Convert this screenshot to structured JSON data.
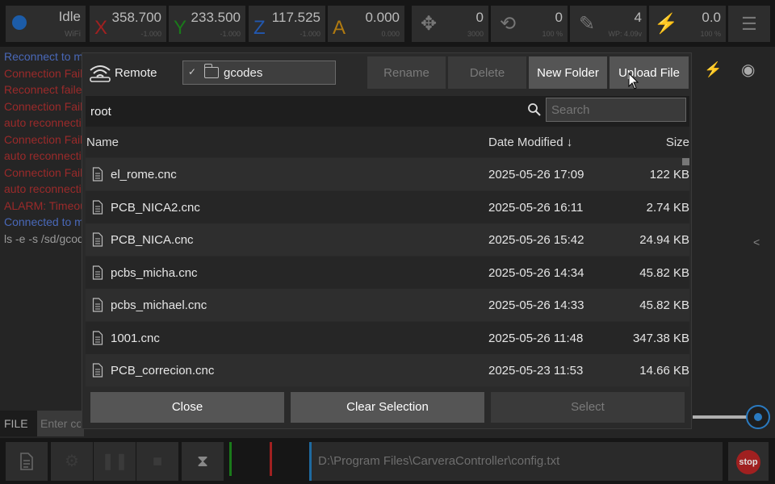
{
  "status_bar": {
    "state": "Idle",
    "connection": "WiFi",
    "axes": [
      {
        "letter": "X",
        "value": "358.700",
        "sub": "-1.000",
        "color": "#a02020"
      },
      {
        "letter": "Y",
        "value": "233.500",
        "sub": "-1.000",
        "color": "#1a7a1a"
      },
      {
        "letter": "Z",
        "value": "117.525",
        "sub": "-1.000",
        "color": "#2258b0"
      },
      {
        "letter": "A",
        "value": "0.000",
        "sub": "0.000",
        "color": "#b07a10"
      }
    ],
    "feed": {
      "value": "0",
      "sub": "3000",
      "icon": "move-arrows-icon"
    },
    "spindle": {
      "value": "0",
      "sub": "100 %",
      "icon": "spindle-icon"
    },
    "tool": {
      "value": "4",
      "sub": "WP: 4.09v",
      "icon": "probe-pen-icon"
    },
    "laser": {
      "value": "0.0",
      "sub": "100 %",
      "icon": "laser-icon"
    },
    "menu_icon": "hamburger-menu-icon"
  },
  "console": {
    "lines": [
      {
        "text": "Reconnect to machine...",
        "kind": "blue"
      },
      {
        "text": "Connection Failed!",
        "kind": "red"
      },
      {
        "text": "Reconnect failed",
        "kind": "red"
      },
      {
        "text": "Connection Failed!",
        "kind": "red"
      },
      {
        "text": "auto reconnecting...",
        "kind": "red"
      },
      {
        "text": "Connection Failed!",
        "kind": "red"
      },
      {
        "text": "auto reconnecting...",
        "kind": "red"
      },
      {
        "text": "Connection Failed!",
        "kind": "red"
      },
      {
        "text": "auto reconnecting...",
        "kind": "red"
      },
      {
        "text": "ALARM: Timeout",
        "kind": "red"
      },
      {
        "text": "Connected to machine",
        "kind": "blue"
      },
      {
        "text": "ls -e -s /sd/gcodes",
        "kind": "gray"
      }
    ]
  },
  "command": {
    "file_label": "FILE",
    "placeholder": "Enter command"
  },
  "bottom_bar": {
    "file_path": "D:\\Program Files\\CarveraController\\config.txt",
    "stop_label": "stop"
  },
  "dialog": {
    "mode_label": "Remote",
    "folder": "gcodes",
    "buttons": {
      "rename": "Rename",
      "delete": "Delete",
      "new_folder": "New Folder",
      "upload": "Upload File"
    },
    "path": "root",
    "search_placeholder": "Search",
    "columns": {
      "name": "Name",
      "date": "Date Modified ↓",
      "size": "Size"
    },
    "files": [
      {
        "name": "el_rome.cnc",
        "date": "2025-05-26 17:09",
        "size": "122 KB"
      },
      {
        "name": "PCB_NICA2.cnc",
        "date": "2025-05-26 16:11",
        "size": "2.74 KB"
      },
      {
        "name": "PCB_NICA.cnc",
        "date": "2025-05-26 15:42",
        "size": "24.94 KB"
      },
      {
        "name": "pcbs_micha.cnc",
        "date": "2025-05-26 14:34",
        "size": "45.82 KB"
      },
      {
        "name": "pcbs_michael.cnc",
        "date": "2025-05-26 14:33",
        "size": "45.82 KB"
      },
      {
        "name": "1001.cnc",
        "date": "2025-05-26 11:48",
        "size": "347.38 KB"
      },
      {
        "name": "PCB_correcion.cnc",
        "date": "2025-05-23 11:53",
        "size": "14.66 KB"
      }
    ],
    "footer": {
      "close": "Close",
      "clear": "Clear Selection",
      "select": "Select"
    }
  }
}
